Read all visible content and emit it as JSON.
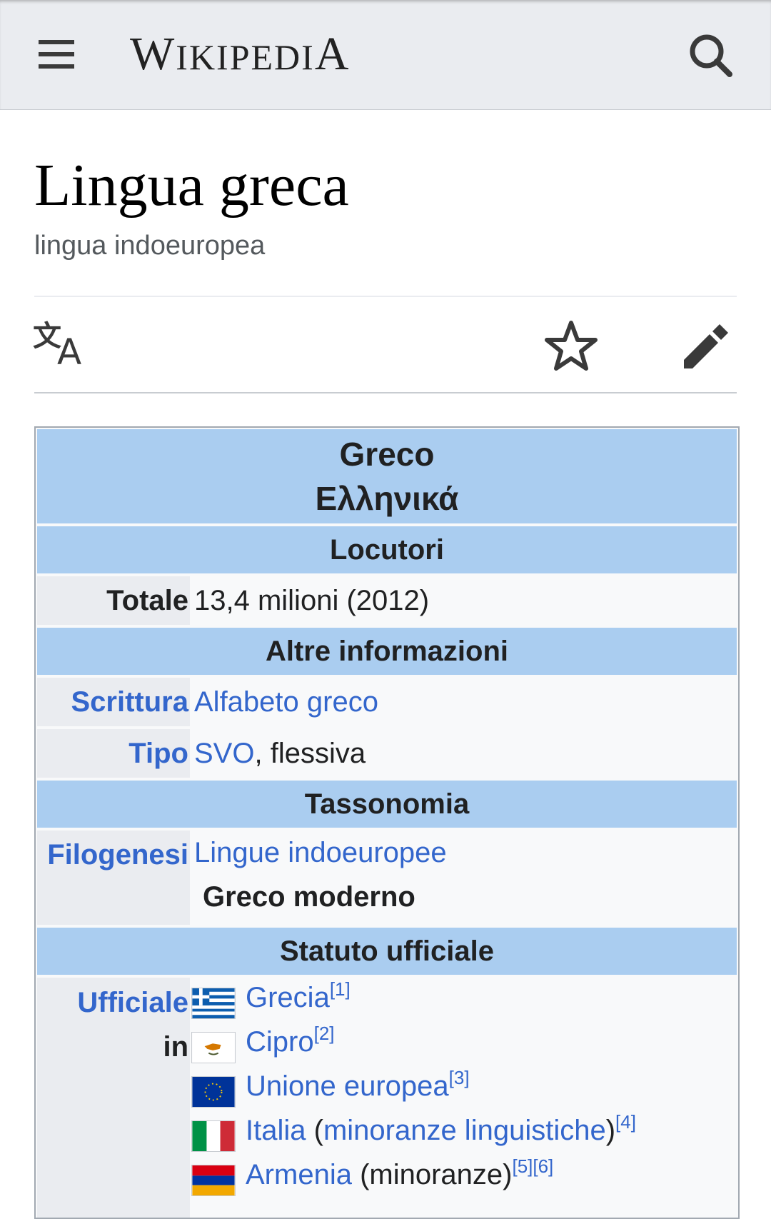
{
  "header": {
    "logo_big_w": "W",
    "logo_small_1": "IKIPEDI",
    "logo_big_a": "A",
    "menu_icon": "hamburger-menu-icon",
    "search_icon": "search-icon"
  },
  "article": {
    "title": "Lingua greca",
    "description": "lingua indoeuropea"
  },
  "actions": {
    "language_icon": "translate-icon",
    "watch_icon": "star-icon",
    "edit_icon": "pencil-icon"
  },
  "infobox": {
    "title_line1": "Greco",
    "title_line2": "Ελληνικά",
    "section_locutori": "Locutori",
    "totale_label": "Totale",
    "totale_value": "13,4 milioni (2012)",
    "section_altre": "Altre informazioni",
    "scrittura_label": "Scrittura",
    "scrittura_value": "Alfabeto greco",
    "tipo_label": "Tipo",
    "tipo_link": "SVO",
    "tipo_rest": ", flessiva",
    "section_tassonomia": "Tassonomia",
    "filogenesi_label": "Filogenesi",
    "filogenesi_link": "Lingue indoeuropee",
    "filogenesi_sub": "Greco moderno",
    "section_statuto": "Statuto ufficiale",
    "ufficiale_label_1": "Ufficiale",
    "ufficiale_label_2": "in",
    "official": [
      {
        "name": "Grecia",
        "pre": "",
        "link2": "",
        "post": "",
        "ref": "[1]"
      },
      {
        "name": "Cipro",
        "pre": "",
        "link2": "",
        "post": "",
        "ref": "[2]"
      },
      {
        "name": "Unione europea",
        "pre": "",
        "link2": "",
        "post": "",
        "ref": "[3]"
      },
      {
        "name": "Italia",
        "pre": " (",
        "link2": "minoranze linguistiche",
        "post": ")",
        "ref": "[4]"
      },
      {
        "name": "Armenia",
        "pre": " (minoranze)",
        "link2": "",
        "post": "",
        "ref": "[5][6]"
      }
    ]
  }
}
